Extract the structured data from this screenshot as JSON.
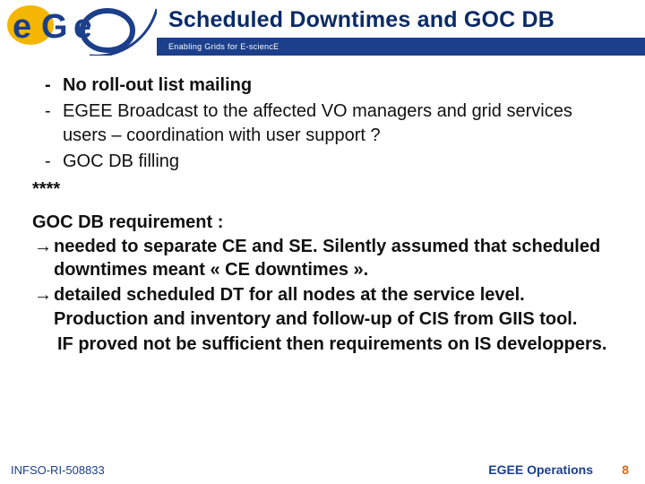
{
  "header": {
    "title": "Scheduled  Downtimes and GOC DB",
    "tagline": "Enabling Grids for E-sciencE",
    "logo_text": "eGee"
  },
  "bullets": {
    "b1": "No roll-out list mailing",
    "b2": "EGEE Broadcast to the affected VO managers and grid services users – coordination with user support ?",
    "b3": "GOC DB filling"
  },
  "separator": "****",
  "requirement_title": "GOC DB requirement :",
  "arrows": {
    "a1": "needed to separate CE and SE. Silently assumed that scheduled downtimes meant « CE downtimes ».",
    "a2": "detailed scheduled DT for all nodes at the service level. Production and inventory and follow-up of CIS from GIIS tool."
  },
  "tail_line": "IF proved not be sufficient then requirements on IS developpers.",
  "footer": {
    "left": "INFSO-RI-508833",
    "right": "EGEE Operations",
    "page": "8"
  },
  "colors": {
    "band": "#1b3f8a",
    "title": "#0b2b66",
    "page": "#d46a1a"
  }
}
